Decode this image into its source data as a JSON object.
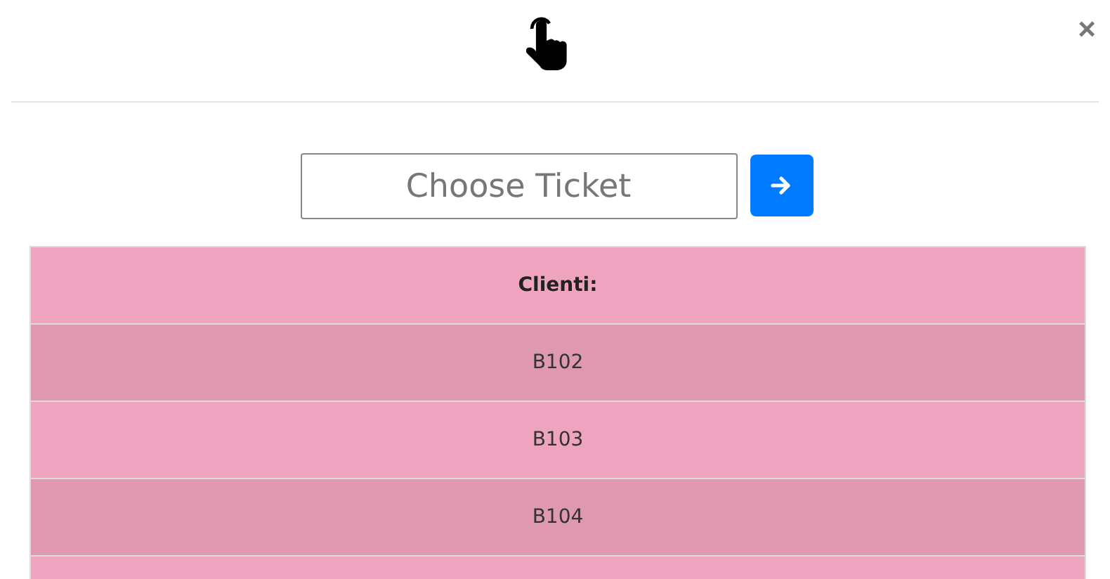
{
  "close": "×",
  "search": {
    "placeholder": "Choose Ticket"
  },
  "table": {
    "header": "Clienti:",
    "rows": [
      {
        "label": "B102"
      },
      {
        "label": "B103"
      },
      {
        "label": "B104"
      }
    ]
  }
}
